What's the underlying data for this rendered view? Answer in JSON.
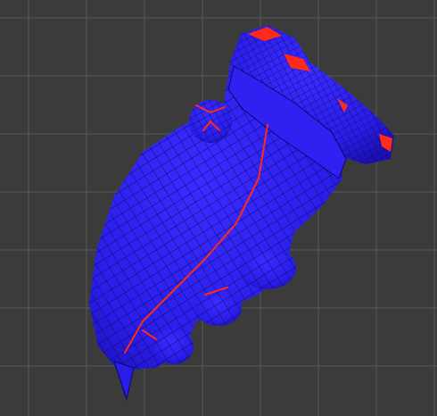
{
  "viewport": {
    "background_color": "#3b3b3b",
    "grid_color": "#5a5a5a",
    "grid_visible": true
  },
  "mesh": {
    "icon": "uv-seam-mesh-glove",
    "face_color": "#2d1ff0",
    "face_shadow_color": "#1a0fb0",
    "wire_color": "#0c0868",
    "seam_color": "#ff2a1a"
  }
}
